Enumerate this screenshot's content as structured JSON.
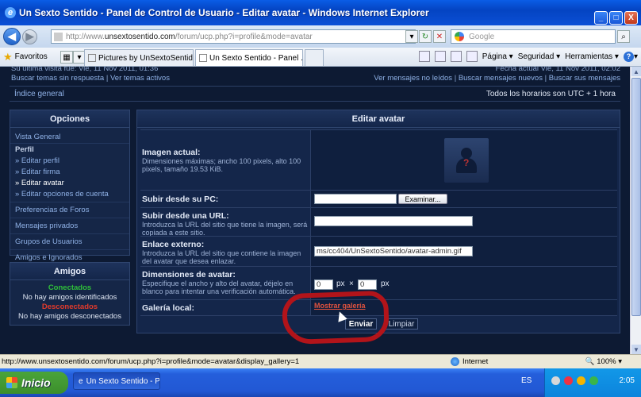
{
  "window": {
    "title": "Un Sexto Sentido - Panel de Control de Usuario - Editar avatar - Windows Internet Explorer",
    "minimize": "_",
    "maximize": "□",
    "close": "X"
  },
  "address": {
    "url_prefix": "http://www.",
    "url_domain": "unsextosentido.com",
    "url_path": "/forum/ucp.php?i=profile&mode=avatar",
    "search_placeholder": "Google"
  },
  "toolbar": {
    "favorites": "Favoritos",
    "tabs": [
      {
        "label": "Pictures by UnSextoSentido - ..."
      },
      {
        "label": "Un Sexto Sentido - Panel ..."
      }
    ],
    "tab_close": "X",
    "tools": {
      "page": "Página",
      "security": "Seguridad",
      "tools": "Herramientas",
      "help": "?"
    }
  },
  "forum": {
    "last_visit": "Su última visita fue: Vie, 11 Nov 2011, 01:36",
    "search_unanswered": "Buscar temas sin respuesta",
    "view_active": "Ver temas activos",
    "sep": "|",
    "current_date": "Fecha actual Vie, 11 Nov 2011, 02:02",
    "unread": "Ver mensajes no leídos",
    "new_posts": "Buscar mensajes nuevos",
    "own_posts": "Buscar sus mensajes",
    "index": "Índice general",
    "timezone": "Todos los horarios son UTC + 1 hora"
  },
  "options": {
    "title": "Opciones",
    "general": "Vista General",
    "profile": "Perfil",
    "edit_profile": "» Editar perfil",
    "edit_signature": "» Editar firma",
    "edit_avatar": "» Editar avatar",
    "edit_account": "» Editar opciones de cuenta",
    "forum_prefs": "Preferencias de Foros",
    "private_messages": "Mensajes privados",
    "user_groups": "Grupos de Usuarios",
    "friends_foes": "Amigos e Ignorados"
  },
  "friends": {
    "title": "Amigos",
    "online": "Conectados",
    "no_online": "No hay amigos identificados",
    "offline": "Desconectados",
    "no_offline": "No hay amigos desconectados"
  },
  "avatar": {
    "title": "Editar avatar",
    "current_label": "Imagen actual:",
    "current_desc": "Dimensiones máximas; ancho 100 pixels, alto 100 pixels, tamaño 19.53 KiB.",
    "upload_pc_label": "Subir desde su PC:",
    "browse": "Examinar...",
    "upload_url_label": "Subir desde una URL:",
    "upload_url_desc": "Introduzca la URL del sitio que tiene la imagen, será copiada a este sitio.",
    "external_label": "Enlace externo:",
    "external_desc": "Introduzca la URL del sitio que contiene la imagen del avatar que desea enlazar.",
    "external_value": "ms/cc404/UnSextoSentido/avatar-admin.gif",
    "dims_label": "Dimensiones de avatar:",
    "dims_desc": "Especifique el ancho y alto del avatar, déjelo en blanco para intentar una verificación automática.",
    "width": "0",
    "height": "0",
    "px": "px",
    "times": "×",
    "gallery_label": "Galería local:",
    "gallery_link": "Mostrar galería",
    "submit": "Enviar",
    "reset": "Limpiar"
  },
  "status": {
    "text": "http://www.unsextosentido.com/forum/ucp.php?i=profile&mode=avatar&display_gallery=1",
    "zone": "Internet",
    "zoom": "100%"
  },
  "taskbar": {
    "start": "Inicio",
    "task": "Un Sexto Sentido - P...",
    "lang": "ES",
    "clock": "2:05"
  },
  "colors": {
    "page_bg": "#0d1a33",
    "annotation": "#b2141a"
  }
}
